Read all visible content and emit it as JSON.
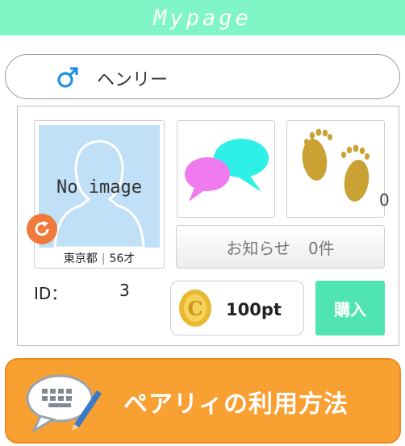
{
  "header": {
    "title": "Mypage"
  },
  "profile": {
    "gender_icon": "male-symbol-icon",
    "name": "ヘンリー",
    "avatar_placeholder": "No image",
    "location": "東京都",
    "separator": "|",
    "age": "56才",
    "id_label": "ID：",
    "id_value": "3"
  },
  "tiles": {
    "messages_icon": "chat-bubbles-icon",
    "footprints_icon": "footprints-icon",
    "footprints_count": "0"
  },
  "notice": {
    "label": "お知らせ",
    "count": "0件"
  },
  "points": {
    "value": "100pt",
    "buy_label": "購入"
  },
  "howto": {
    "label": "ペアリィの利用方法"
  },
  "colors": {
    "header_bg": "#80f5c6",
    "accent_teal": "#50e4b2",
    "banner_orange": "#f9a032",
    "refresh_orange": "#ef7a3b",
    "coin_gold": "#e8b830"
  }
}
